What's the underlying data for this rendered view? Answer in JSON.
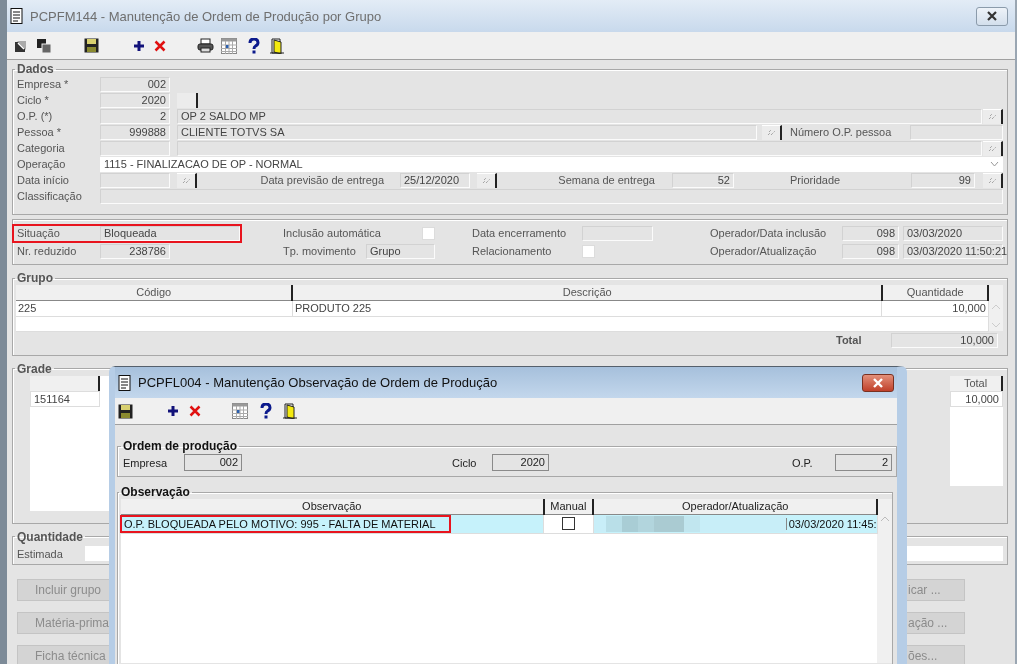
{
  "window": {
    "title": "PCPFM144 - Manutenção de Ordem de Produção por Grupo"
  },
  "dados": {
    "title": "Dados",
    "empresa": {
      "label": "Empresa *",
      "value": "002"
    },
    "ciclo": {
      "label": "Ciclo *",
      "value": "2020"
    },
    "op": {
      "label": "O.P. (*)",
      "value": "2",
      "description": "OP 2 SALDO MP"
    },
    "pessoa": {
      "label": "Pessoa *",
      "value": "999888",
      "description": "CLIENTE TOTVS SA",
      "number_label": "Número O.P. pessoa"
    },
    "categoria": {
      "label": "Categoria"
    },
    "operacao": {
      "label": "Operação",
      "value": "1115 - FINALIZACAO DE OP - NORMAL"
    },
    "data_inicio": {
      "label": "Data início"
    },
    "data_previsao": {
      "label": "Data previsão de entrega",
      "value": "25/12/2020"
    },
    "semana": {
      "label": "Semana de entrega",
      "value": "52"
    },
    "prioridade": {
      "label": "Prioridade",
      "value": "99"
    },
    "classificacao": {
      "label": "Classificação"
    }
  },
  "status": {
    "situacao": {
      "label": "Situação",
      "value": "Bloqueada",
      "highlighted": true
    },
    "nr_reduzido": {
      "label": "Nr. reduzido",
      "value": "238786",
      "highlighted": false
    },
    "inclusao_automatica": {
      "label": "Inclusão automática",
      "checked": false
    },
    "tp_movimento": {
      "label": "Tp. movimento",
      "value": "Grupo"
    },
    "data_encerramento": {
      "label": "Data encerramento"
    },
    "relacionamento": {
      "label": "Relacionamento",
      "checked": false
    },
    "operador_inclusao": {
      "label": "Operador/Data inclusão",
      "operator": "098",
      "date": "03/03/2020"
    },
    "operador_atualizacao": {
      "label": "Operador/Atualização",
      "operator": "098",
      "date": "03/03/2020 11:50:21"
    }
  },
  "grupo": {
    "title": "Grupo",
    "columns": [
      "Código",
      "Descrição",
      "Quantidade"
    ],
    "rows": [
      [
        "225",
        "PRODUTO 225",
        "10,000"
      ]
    ],
    "total_label": "Total",
    "total": "10,000"
  },
  "grade": {
    "title": "Grade",
    "rows": [
      "151164"
    ],
    "total_column": "Total",
    "total": "10,000"
  },
  "quantidade": {
    "title": "Quantidade",
    "estimada_label": "Estimada"
  },
  "buttons_left": [
    {
      "label": "Incluir grupo",
      "disabled": true
    },
    {
      "label": "Matéria-prima",
      "disabled": true
    },
    {
      "label": "Ficha técnica",
      "disabled": true
    }
  ],
  "buttons_right": [
    {
      "label": "icar ...",
      "disabled": true
    },
    {
      "label": "ação ...",
      "disabled": true
    },
    {
      "label": "ões...",
      "disabled": true
    }
  ],
  "dialog": {
    "title": "PCPFL004 - Manutenção Observação de Ordem de Produção",
    "ordem": {
      "title": "Ordem de produção",
      "empresa_label": "Empresa",
      "empresa": "002",
      "ciclo_label": "Ciclo",
      "ciclo": "2020",
      "op_label": "O.P.",
      "op": "2"
    },
    "observacao": {
      "title": "Observação",
      "columns": [
        "Observação",
        "Manual",
        "Operador/Atualização"
      ],
      "rows": [
        {
          "text": "O.P. BLOQUEADA PELO MOTIVO: 995 - FALTA DE MATERIAL",
          "highlighted": true,
          "manual": false,
          "updated": "03/03/2020 11:45:",
          "selected": true
        }
      ]
    }
  }
}
